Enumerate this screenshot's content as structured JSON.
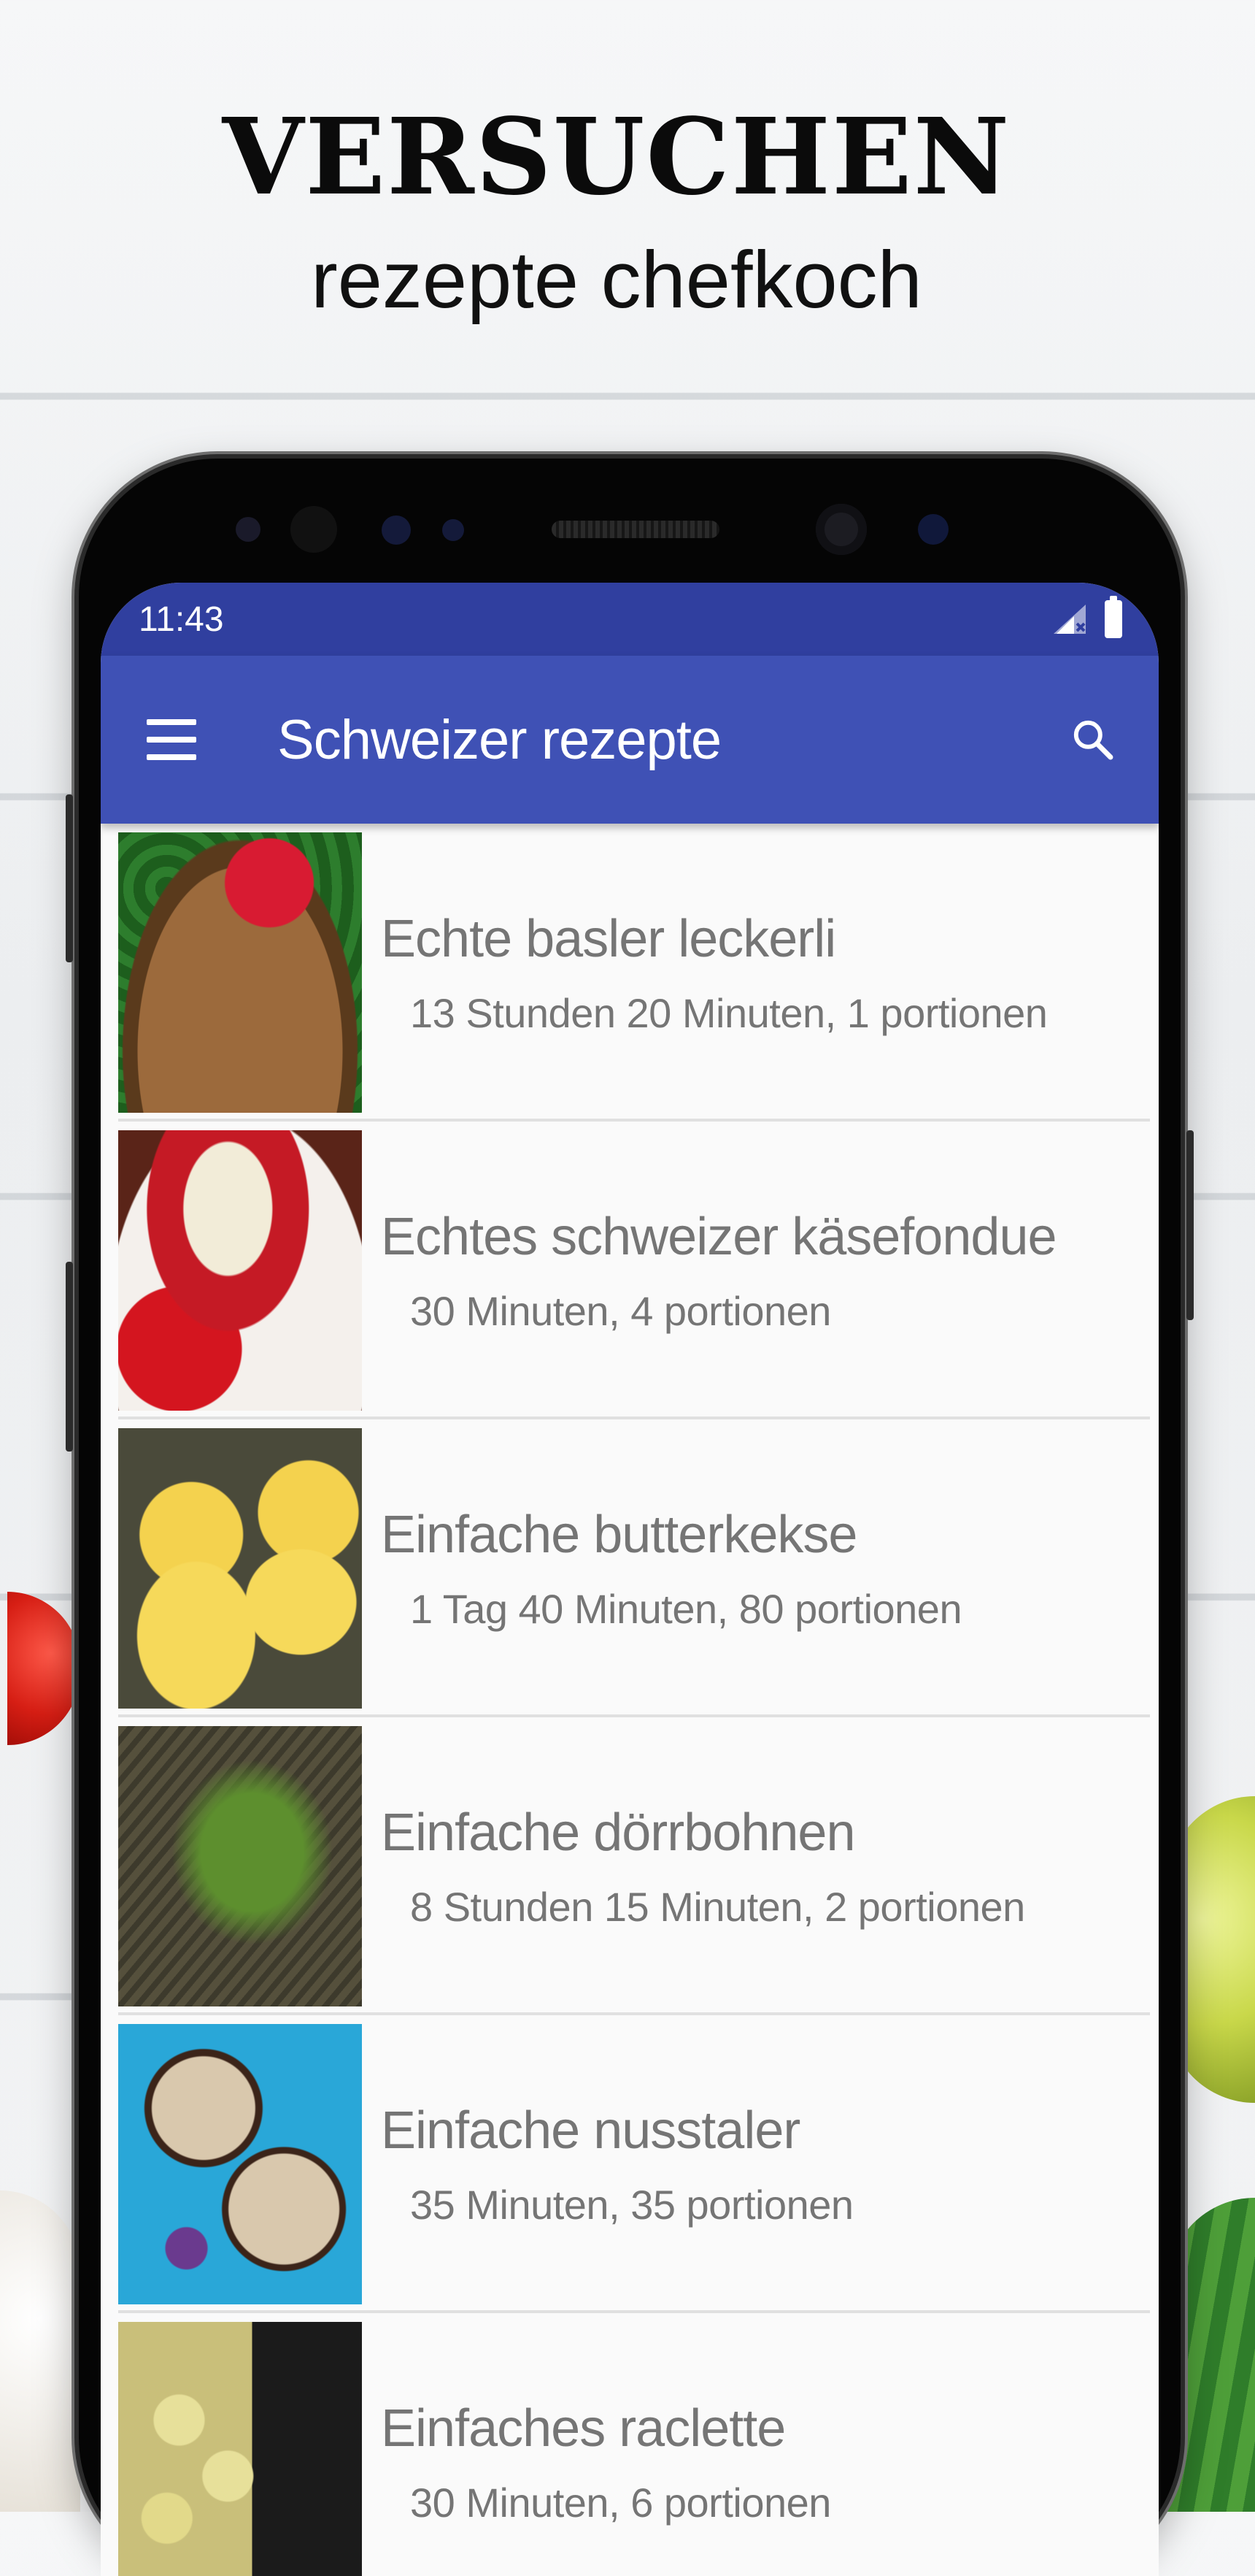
{
  "promo": {
    "headline": "VERSUCHEN",
    "subheadline": "rezepte chefkoch"
  },
  "status_bar": {
    "time": "11:43",
    "icons": [
      "signal-icon",
      "battery-icon"
    ]
  },
  "app_bar": {
    "title": "Schweizer rezepte",
    "left_icon": "menu-icon",
    "right_icon": "search-icon"
  },
  "colors": {
    "status_bar": "#303f9f",
    "app_bar": "#3f51b5",
    "list_text": "#757575",
    "list_background": "#fafafa"
  },
  "recipes": [
    {
      "title": "Echte basler leckerli",
      "details": "13 Stunden 20 Minuten, 1 portionen"
    },
    {
      "title": "Echtes schweizer käsefondue",
      "details": "30 Minuten, 4 portionen"
    },
    {
      "title": "Einfache butterkekse",
      "details": "1 Tag 40 Minuten, 80 portionen"
    },
    {
      "title": "Einfache dörrbohnen",
      "details": "8 Stunden 15 Minuten, 2 portionen"
    },
    {
      "title": "Einfache nusstaler",
      "details": "35 Minuten, 35 portionen"
    },
    {
      "title": "Einfaches raclette",
      "details": "30 Minuten, 6 portionen"
    }
  ]
}
